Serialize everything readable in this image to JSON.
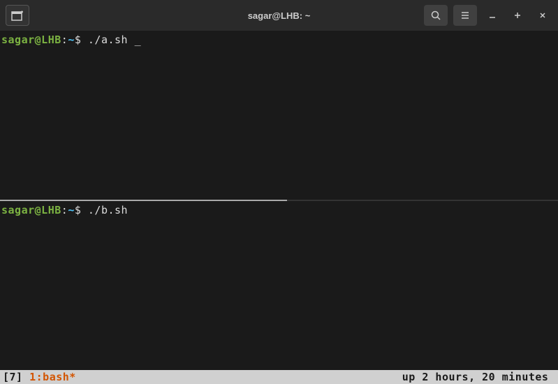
{
  "titlebar": {
    "title": "sagar@LHB: ~"
  },
  "panes": {
    "top": {
      "user_host": "sagar@LHB",
      "path": "~",
      "command": "./a.sh",
      "cursor": "_"
    },
    "bottom": {
      "user_host": "sagar@LHB",
      "path": "~",
      "command": "./b.sh"
    }
  },
  "statusbar": {
    "session": "[7] ",
    "window": "1:bash*",
    "uptime": "up 2 hours, 20 minutes "
  }
}
